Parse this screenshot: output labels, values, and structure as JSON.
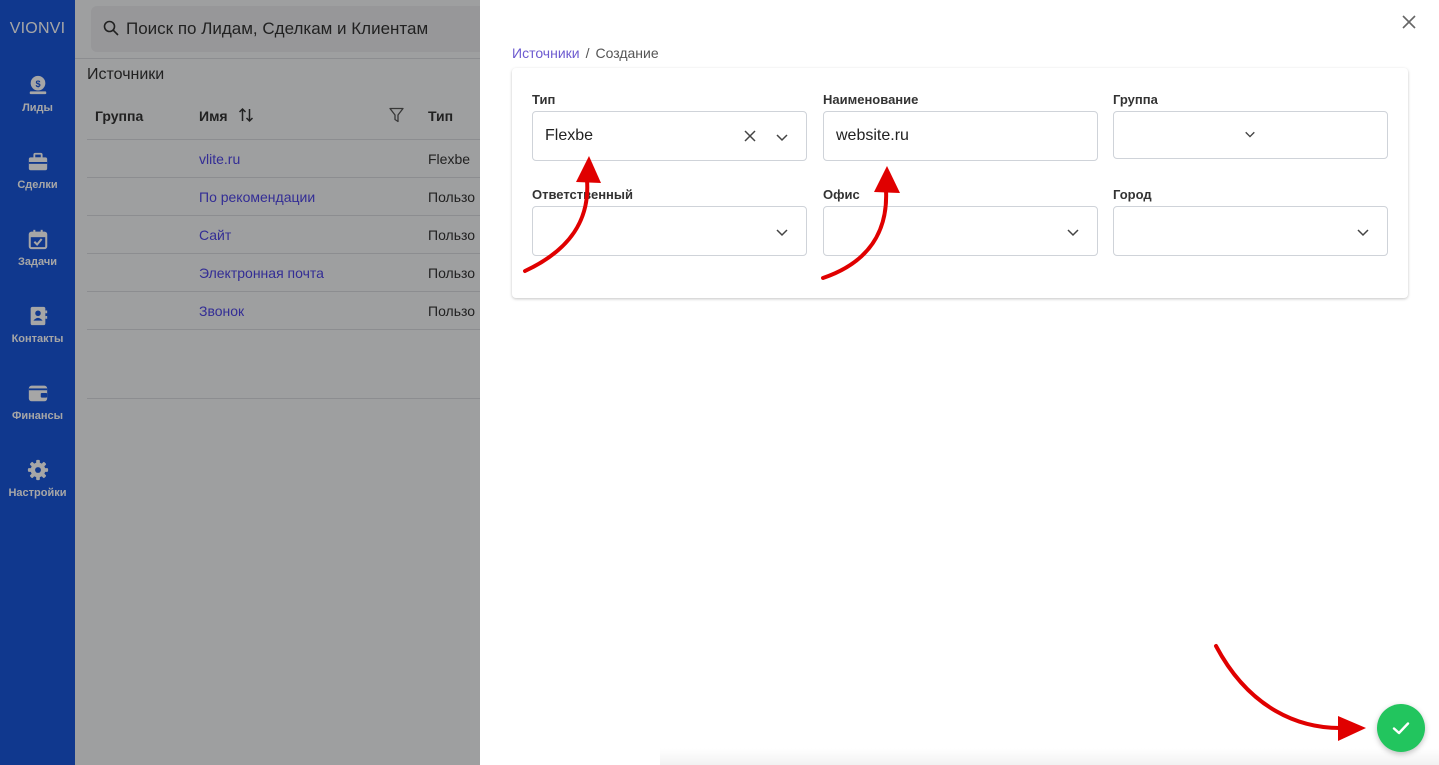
{
  "sidebar": {
    "brand": "VIONVI",
    "items": [
      {
        "label": "Лиды",
        "icon": "money-bag-icon"
      },
      {
        "label": "Сделки",
        "icon": "briefcase-icon"
      },
      {
        "label": "Задачи",
        "icon": "calendar-check-icon"
      },
      {
        "label": "Контакты",
        "icon": "contact-book-icon"
      },
      {
        "label": "Финансы",
        "icon": "wallet-icon"
      },
      {
        "label": "Настройки",
        "icon": "gear-icon"
      }
    ]
  },
  "search": {
    "placeholder": "Поиск по Лидам, Сделкам и Клиентам"
  },
  "background_page": {
    "title": "Источники",
    "columns": {
      "group": "Группа",
      "name": "Имя",
      "type": "Тип"
    },
    "rows": [
      {
        "name": "vlite.ru",
        "type": "Flexbe"
      },
      {
        "name": "По рекомендации",
        "type": "Пользо"
      },
      {
        "name": "Сайт",
        "type": "Пользо"
      },
      {
        "name": "Электронная почта",
        "type": "Пользо"
      },
      {
        "name": "Звонок",
        "type": "Пользо"
      }
    ]
  },
  "drawer": {
    "breadcrumb": {
      "link": "Источники",
      "separator": "/",
      "current": "Создание"
    },
    "fields": {
      "type": {
        "label": "Тип",
        "value": "Flexbe"
      },
      "name": {
        "label": "Наименование",
        "value": "website.ru"
      },
      "group": {
        "label": "Группа",
        "value": ""
      },
      "responsible": {
        "label": "Ответственный",
        "value": ""
      },
      "office": {
        "label": "Офис",
        "value": ""
      },
      "city": {
        "label": "Город",
        "value": ""
      }
    }
  },
  "colors": {
    "sidebar": "#1a56db",
    "link": "#4f46e5",
    "confirm": "#22c55e",
    "annotation_arrow": "#e00000"
  }
}
